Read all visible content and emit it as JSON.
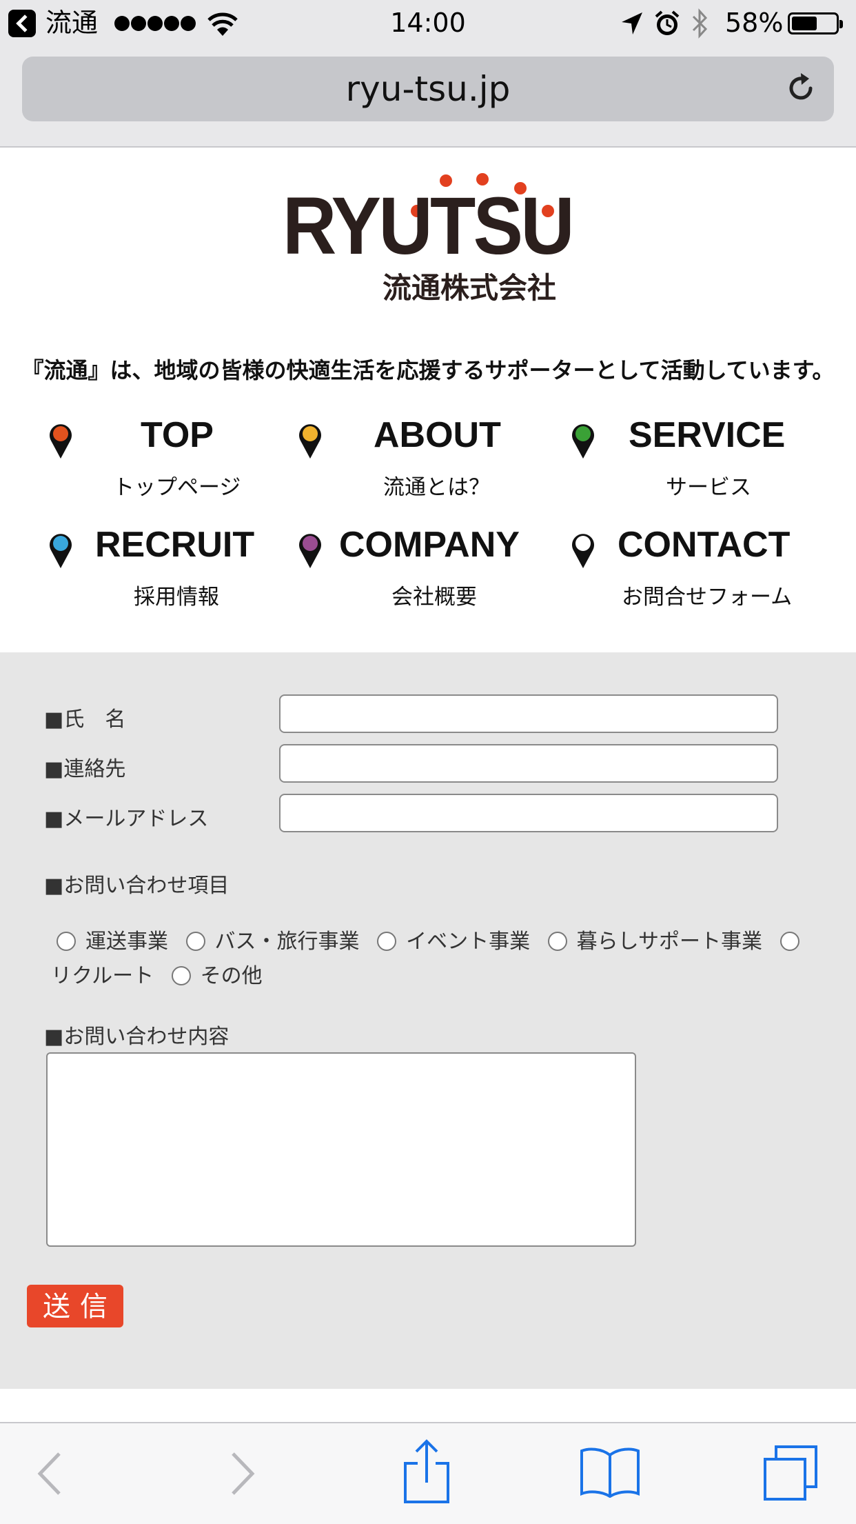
{
  "status_bar": {
    "back_app": "流通",
    "time": "14:00",
    "battery": "58%",
    "battery_level": 0.58
  },
  "browser": {
    "url": "ryu-tsu.jp"
  },
  "logo": {
    "wordmark": "RYUTSU",
    "company_name": "流通株式会社",
    "colors": {
      "text": "#2b1f1d",
      "dots": "#e2401f"
    }
  },
  "tagline": "『流通』は、地域の皆様の快適生活を応援するサポーターとして活動しています。",
  "nav": [
    {
      "title": "TOP",
      "sub": "トップページ",
      "pin_color": "#e2521e"
    },
    {
      "title": "ABOUT",
      "sub": "流通とは？",
      "pin_color": "#f0b22e"
    },
    {
      "title": "SERVICE",
      "sub": "サービス",
      "pin_color": "#3aa136"
    },
    {
      "title": "RECRUIT",
      "sub": "採用情報",
      "pin_color": "#39a7dc"
    },
    {
      "title": "COMPANY",
      "sub": "会社概要",
      "pin_color": "#9a4d92"
    },
    {
      "title": "CONTACT",
      "sub": "お問合せフォーム",
      "pin_color": "#ffffff"
    }
  ],
  "form": {
    "name_label": "■氏　名",
    "phone_label": "■連絡先",
    "email_label": "■メールアドレス",
    "inquiry_type_label": "■お問い合わせ項目",
    "options": [
      "運送事業",
      "バス・旅行事業",
      "イベント事業",
      "暮らしサポート事業",
      "リクルート",
      "その他"
    ],
    "content_label": "■お問い合わせ内容",
    "submit_label": "送信",
    "submit_color": "#e8472a"
  },
  "toolbar": {
    "icons": [
      "back-icon",
      "forward-icon",
      "share-icon",
      "bookmarks-icon",
      "tabs-icon"
    ],
    "accent": "#1a73e8"
  }
}
